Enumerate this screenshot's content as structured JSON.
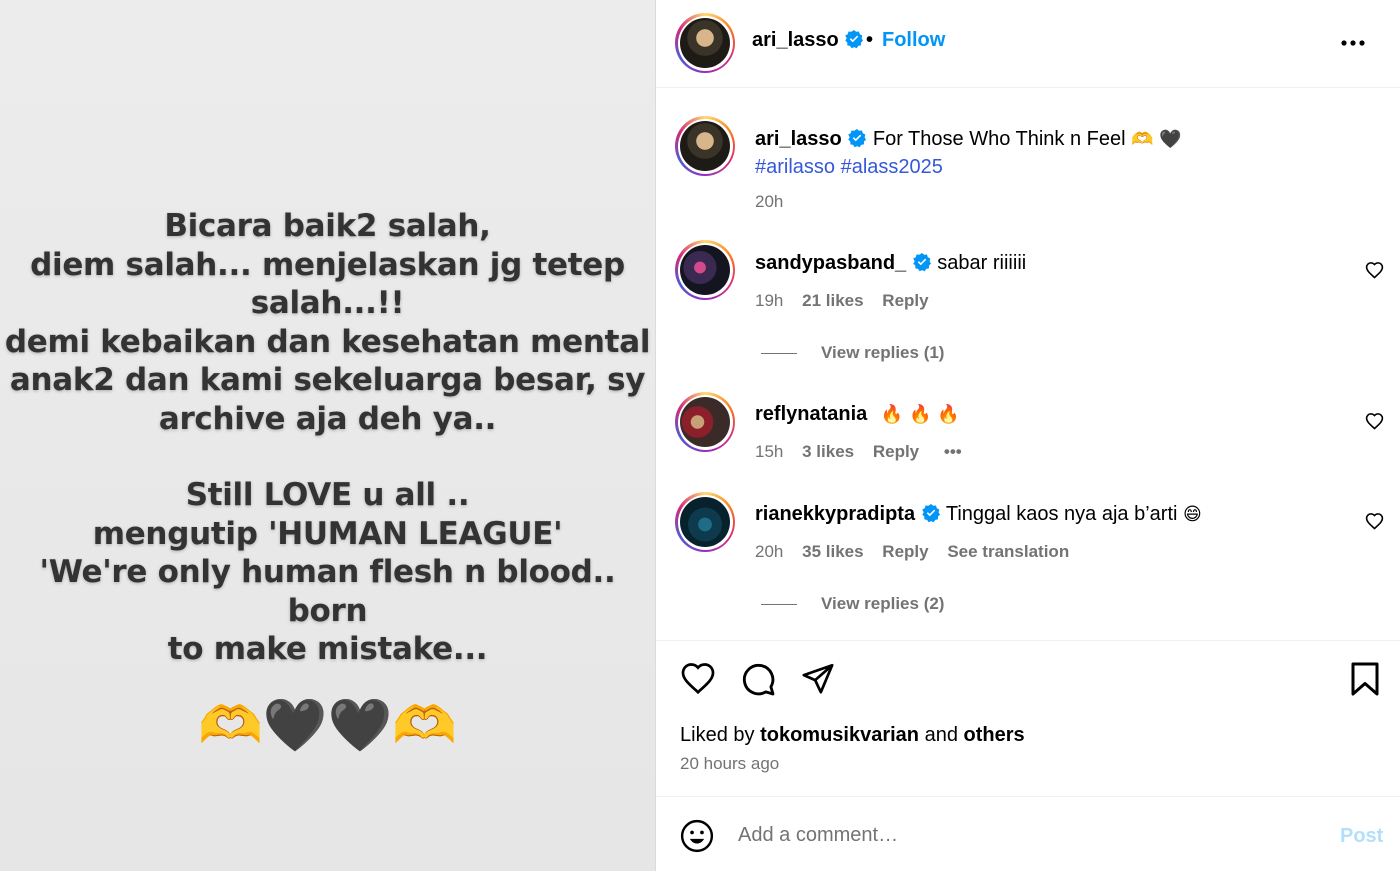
{
  "media": {
    "story_lines_1": [
      "Bicara baik2 salah,",
      "diem salah... menjelaskan jg tetep",
      "salah...!!",
      "demi kebaikan dan kesehatan mental",
      "anak2 dan kami sekeluarga besar, sy",
      "archive aja deh ya.."
    ],
    "story_lines_2": [
      "Still LOVE u all ..",
      "mengutip  'HUMAN LEAGUE'",
      "'We're only human flesh n blood.. born",
      "to make mistake..."
    ],
    "emojis": "🫶🖤🖤🫶"
  },
  "header": {
    "username": "ari_lasso",
    "dot": "•",
    "follow_label": "Follow"
  },
  "caption": {
    "username": "ari_lasso",
    "text": "For Those Who Think n Feel",
    "emojis": "🫶 🖤",
    "hashtags": "#arilasso #alass2025",
    "time": "20h"
  },
  "comments": [
    {
      "username": "sandypasband_",
      "verified": true,
      "text": "sabar riiiiii",
      "time": "19h",
      "likes": "21 likes",
      "reply_label": "Reply",
      "view_replies": "View replies (1)"
    },
    {
      "username": "reflynatania",
      "verified": false,
      "text": "🔥 🔥 🔥",
      "time": "15h",
      "likes": "3 likes",
      "reply_label": "Reply",
      "more": "•••"
    },
    {
      "username": "rianekkypradipta",
      "verified": true,
      "text": "Tinggal kaos nya aja b’arti",
      "emoji": "😄",
      "time": "20h",
      "likes": "35 likes",
      "reply_label": "Reply",
      "translation_label": "See translation",
      "view_replies": "View replies (2)"
    }
  ],
  "likes": {
    "prefix": "Liked by",
    "user": "tokomusikvarian",
    "conj": "and",
    "others": "others",
    "ago": "20 hours ago"
  },
  "comment_box": {
    "placeholder": "Add a comment…",
    "post_label": "Post"
  },
  "icons": {
    "verified": "verified-badge-icon",
    "more": "more-options-icon",
    "heart": "heart-icon",
    "comment": "comment-bubble-icon",
    "share": "paper-plane-icon",
    "save": "bookmark-icon",
    "emoji": "smiley-face-icon"
  },
  "colors": {
    "verified_blue": "#0095f6",
    "hashtag_blue": "#3558d9",
    "muted": "#737373",
    "post_disabled": "#b2dffc"
  }
}
